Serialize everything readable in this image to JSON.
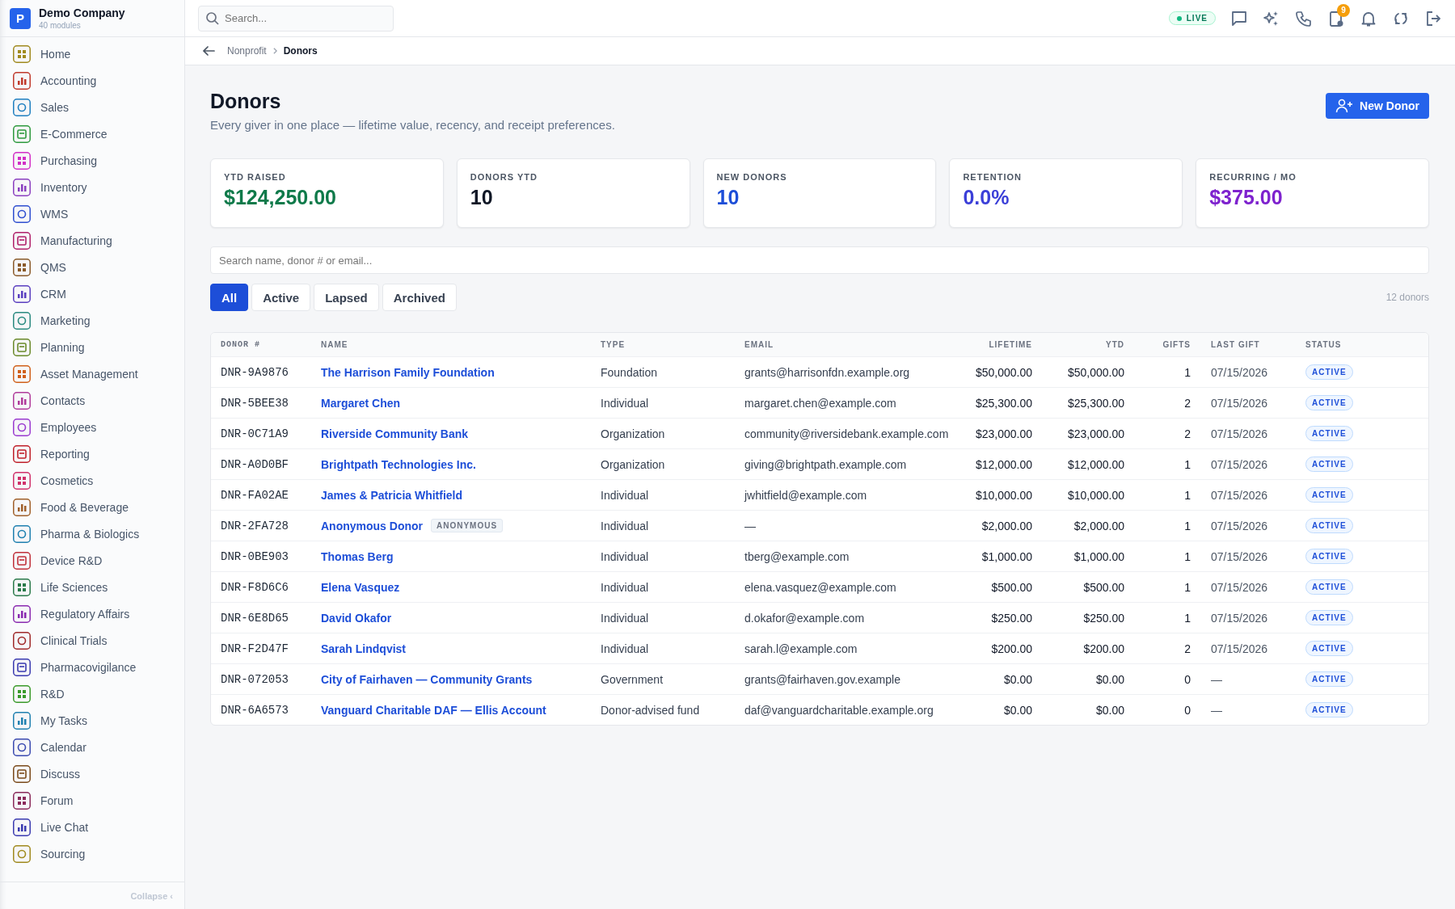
{
  "company": {
    "logo": "P",
    "name": "Demo Company",
    "subtitle": "40 modules"
  },
  "sidebar": {
    "items": [
      {
        "label": "Home",
        "color": "#a08a1e",
        "selected": false
      },
      {
        "label": "Accounting",
        "color": "#c0392b",
        "selected": false
      },
      {
        "label": "Sales",
        "color": "#1f7fc0",
        "selected": false
      },
      {
        "label": "E-Commerce",
        "color": "#2e9a3e",
        "selected": false
      },
      {
        "label": "Purchasing",
        "color": "#d22fc6",
        "selected": false
      },
      {
        "label": "Inventory",
        "color": "#8a3fc0",
        "selected": false
      },
      {
        "label": "WMS",
        "color": "#2f4fd0",
        "selected": false
      },
      {
        "label": "Manufacturing",
        "color": "#b0206a",
        "selected": false
      },
      {
        "label": "QMS",
        "color": "#8a5a2a",
        "selected": false
      },
      {
        "label": "CRM",
        "color": "#5a3fc0",
        "selected": false
      },
      {
        "label": "Marketing",
        "color": "#2a8a80",
        "selected": false
      },
      {
        "label": "Planning",
        "color": "#6a8a2a",
        "selected": false
      },
      {
        "label": "Asset Management",
        "color": "#d0601a",
        "selected": false
      },
      {
        "label": "Contacts",
        "color": "#b03a9a",
        "selected": false
      },
      {
        "label": "Employees",
        "color": "#9a3ad0",
        "selected": false
      },
      {
        "label": "Reporting",
        "color": "#c0202a",
        "selected": false
      },
      {
        "label": "Cosmetics",
        "color": "#d0306a",
        "selected": false
      },
      {
        "label": "Food & Beverage",
        "color": "#a0602a",
        "selected": false
      },
      {
        "label": "Pharma & Biologics",
        "color": "#1f80b0",
        "selected": false
      },
      {
        "label": "Device R&D",
        "color": "#c0303a",
        "selected": false
      },
      {
        "label": "Life Sciences",
        "color": "#2a7a4a",
        "selected": false
      },
      {
        "label": "Regulatory Affairs",
        "color": "#8a2ab0",
        "selected": false
      },
      {
        "label": "Clinical Trials",
        "color": "#a02a2a",
        "selected": false
      },
      {
        "label": "Pharmacovigilance",
        "color": "#3a3ab0",
        "selected": false
      },
      {
        "label": "R&D",
        "color": "#3a9a2a",
        "selected": false
      },
      {
        "label": "My Tasks",
        "color": "#1f80b0",
        "selected": false
      },
      {
        "label": "Calendar",
        "color": "#3a4ab0",
        "selected": false
      },
      {
        "label": "Discuss",
        "color": "#7a4a1a",
        "selected": false
      },
      {
        "label": "Forum",
        "color": "#8a2a5a",
        "selected": false
      },
      {
        "label": "Live Chat",
        "color": "#3a3ab0",
        "selected": false
      },
      {
        "label": "Sourcing",
        "color": "#a08a1e",
        "selected": false
      }
    ],
    "collapse": "Collapse",
    "collapse_icon": "‹"
  },
  "topbar": {
    "search": {
      "placeholder": "Search..."
    },
    "live": "LIVE",
    "badge": "9"
  },
  "breadcrumb": [
    "Nonprofit",
    "Donors"
  ],
  "page": {
    "title": "Donors",
    "subtitle": "Every giver in one place — lifetime value, recency, and receipt preferences.",
    "new_button": "New Donor"
  },
  "stats": [
    {
      "label": "YTD RAISED",
      "value": "$124,250.00",
      "color": "#0f7a4a"
    },
    {
      "label": "DONORS YTD",
      "value": "10",
      "color": "#111827"
    },
    {
      "label": "NEW DONORS",
      "value": "10",
      "color": "#1d4ed8"
    },
    {
      "label": "RETENTION",
      "value": "0.0%",
      "color": "#3b3fd8"
    },
    {
      "label": "RECURRING / MO",
      "value": "$375.00",
      "color": "#7e22ce"
    }
  ],
  "filter": {
    "placeholder": "Search name, donor # or email..."
  },
  "tabs": [
    {
      "label": "All",
      "selected": true
    },
    {
      "label": "Active",
      "selected": false
    },
    {
      "label": "Lapsed",
      "selected": false
    },
    {
      "label": "Archived",
      "selected": false
    }
  ],
  "count": "12 donors",
  "table": {
    "columns": [
      "DONOR #",
      "NAME",
      "TYPE",
      "EMAIL",
      "LIFETIME",
      "YTD",
      "GIFTS",
      "LAST GIFT",
      "STATUS"
    ],
    "rows": [
      {
        "id": "DNR-9A9876",
        "name": "The Harrison Family Foundation",
        "type": "Foundation",
        "email": "grants@harrisonfdn.example.org",
        "lifetime": "$50,000.00",
        "ytd": "$50,000.00",
        "gifts": "1",
        "last": "07/15/2026",
        "status": "ACTIVE"
      },
      {
        "id": "DNR-5BEE38",
        "name": "Margaret Chen",
        "type": "Individual",
        "email": "margaret.chen@example.com",
        "lifetime": "$25,300.00",
        "ytd": "$25,300.00",
        "gifts": "2",
        "last": "07/15/2026",
        "status": "ACTIVE"
      },
      {
        "id": "DNR-0C71A9",
        "name": "Riverside Community Bank",
        "type": "Organization",
        "email": "community@riversidebank.example.com",
        "lifetime": "$23,000.00",
        "ytd": "$23,000.00",
        "gifts": "2",
        "last": "07/15/2026",
        "status": "ACTIVE"
      },
      {
        "id": "DNR-A0D0BF",
        "name": "Brightpath Technologies Inc.",
        "type": "Organization",
        "email": "giving@brightpath.example.com",
        "lifetime": "$12,000.00",
        "ytd": "$12,000.00",
        "gifts": "1",
        "last": "07/15/2026",
        "status": "ACTIVE"
      },
      {
        "id": "DNR-FA02AE",
        "name": "James & Patricia Whitfield",
        "type": "Individual",
        "email": "jwhitfield@example.com",
        "lifetime": "$10,000.00",
        "ytd": "$10,000.00",
        "gifts": "1",
        "last": "07/15/2026",
        "status": "ACTIVE"
      },
      {
        "id": "DNR-2FA728",
        "name": "Anonymous Donor",
        "tag": "ANONYMOUS",
        "type": "Individual",
        "email": "—",
        "lifetime": "$2,000.00",
        "ytd": "$2,000.00",
        "gifts": "1",
        "last": "07/15/2026",
        "status": "ACTIVE"
      },
      {
        "id": "DNR-0BE903",
        "name": "Thomas Berg",
        "type": "Individual",
        "email": "tberg@example.com",
        "lifetime": "$1,000.00",
        "ytd": "$1,000.00",
        "gifts": "1",
        "last": "07/15/2026",
        "status": "ACTIVE"
      },
      {
        "id": "DNR-F8D6C6",
        "name": "Elena Vasquez",
        "type": "Individual",
        "email": "elena.vasquez@example.com",
        "lifetime": "$500.00",
        "ytd": "$500.00",
        "gifts": "1",
        "last": "07/15/2026",
        "status": "ACTIVE"
      },
      {
        "id": "DNR-6E8D65",
        "name": "David Okafor",
        "type": "Individual",
        "email": "d.okafor@example.com",
        "lifetime": "$250.00",
        "ytd": "$250.00",
        "gifts": "1",
        "last": "07/15/2026",
        "status": "ACTIVE"
      },
      {
        "id": "DNR-F2D47F",
        "name": "Sarah Lindqvist",
        "type": "Individual",
        "email": "sarah.l@example.com",
        "lifetime": "$200.00",
        "ytd": "$200.00",
        "gifts": "2",
        "last": "07/15/2026",
        "status": "ACTIVE"
      },
      {
        "id": "DNR-072053",
        "name": "City of Fairhaven — Community Grants",
        "type": "Government",
        "email": "grants@fairhaven.gov.example",
        "lifetime": "$0.00",
        "ytd": "$0.00",
        "gifts": "0",
        "last": "—",
        "status": "ACTIVE"
      },
      {
        "id": "DNR-6A6573",
        "name": "Vanguard Charitable DAF — Ellis Account",
        "type": "Donor-advised fund",
        "email": "daf@vanguardcharitable.example.org",
        "lifetime": "$0.00",
        "ytd": "$0.00",
        "gifts": "0",
        "last": "—",
        "status": "ACTIVE"
      }
    ]
  }
}
